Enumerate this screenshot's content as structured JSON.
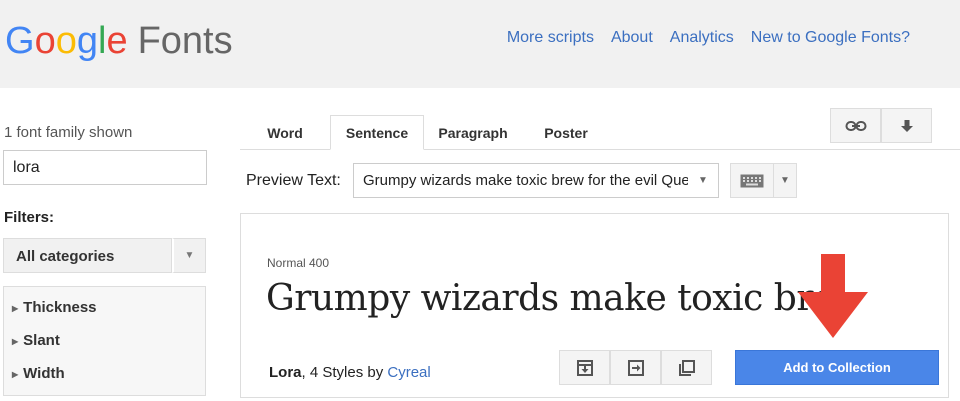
{
  "header": {
    "logo_letters": [
      "G",
      "o",
      "o",
      "g",
      "l",
      "e"
    ],
    "logo_suffix": "Fonts",
    "nav": [
      "More scripts",
      "About",
      "Analytics",
      "New to Google Fonts?"
    ]
  },
  "sidebar": {
    "family_count": "1 font family shown",
    "search_value": "lora",
    "filters_label": "Filters:",
    "category_selected": "All categories",
    "filters": [
      "Thickness",
      "Slant",
      "Width"
    ]
  },
  "tabs": [
    {
      "label": "Word",
      "active": false
    },
    {
      "label": "Sentence",
      "active": true
    },
    {
      "label": "Paragraph",
      "active": false
    },
    {
      "label": "Poster",
      "active": false
    }
  ],
  "toolbar": {
    "icons": [
      "link-icon",
      "download-icon"
    ]
  },
  "preview": {
    "label": "Preview Text:",
    "value": "Grumpy wizards make toxic brew for the evil Queen and Jack."
  },
  "card": {
    "style_label": "Normal 400",
    "sample_text": "Grumpy wizards make toxic bre           the",
    "family": "Lora",
    "styles_text": ", 4 Styles by ",
    "author": "Cyreal",
    "add_label": "Add to Collection",
    "annotation_color": "#ea4335"
  },
  "colors": {
    "accent": "#4a86e8",
    "link": "#3b6fc0",
    "header_bg": "#f1f1f1"
  }
}
